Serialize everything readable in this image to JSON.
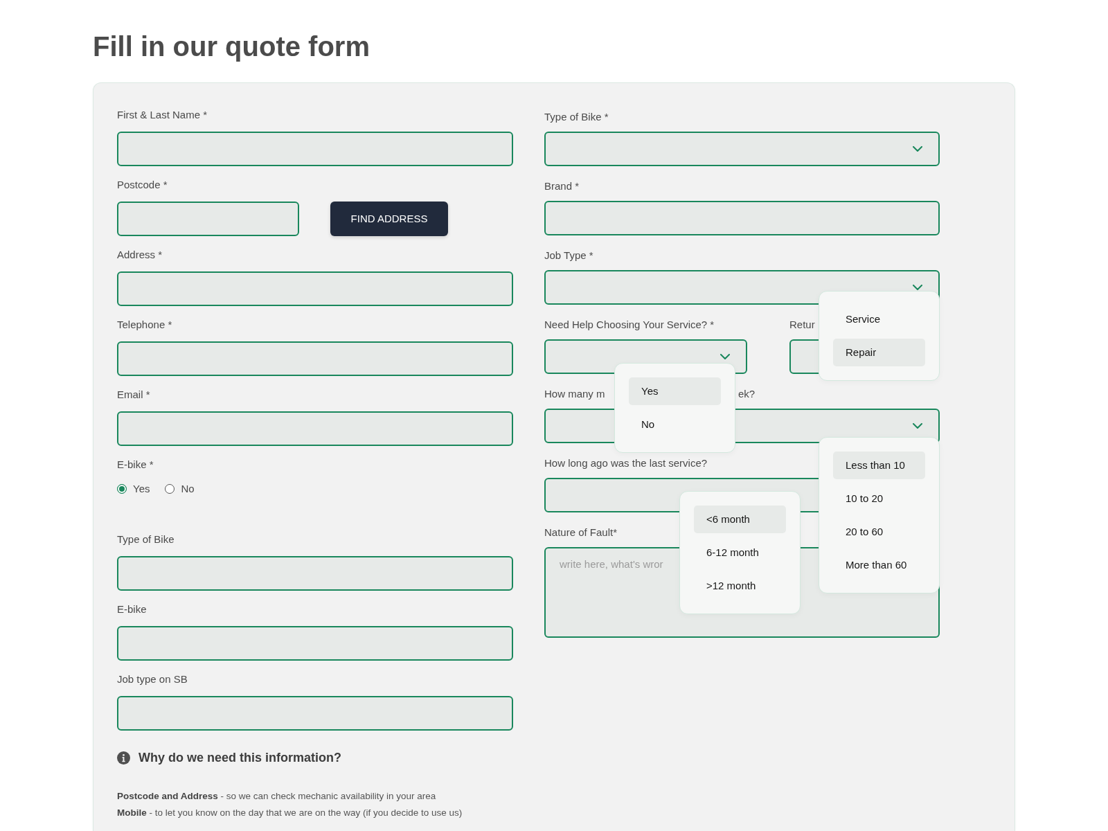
{
  "title": "Fill in our quote form",
  "left_fields": [
    {
      "kind": "input",
      "label": "First & Last Name *"
    },
    {
      "kind": "postcode",
      "label": "Postcode *",
      "button": "FIND ADDRESS"
    },
    {
      "kind": "input",
      "label": "Address *"
    },
    {
      "kind": "input",
      "label": "Telephone *"
    },
    {
      "kind": "input",
      "label": "Email *"
    },
    {
      "kind": "radio",
      "label": "E-bike *",
      "options": [
        {
          "label": "Yes",
          "selected": true
        },
        {
          "label": "No",
          "selected": false
        }
      ]
    },
    {
      "kind": "input",
      "label": "Type of Bike"
    },
    {
      "kind": "input",
      "label": "E-bike"
    },
    {
      "kind": "input",
      "label": "Job type on SB"
    }
  ],
  "right_fields": [
    {
      "kind": "select",
      "label": "Type of Bike *"
    },
    {
      "kind": "input",
      "label": "Brand *"
    },
    {
      "kind": "select",
      "label": "Job Type *",
      "menu": [
        {
          "label": "Service",
          "selected": false
        },
        {
          "label": "Repair",
          "selected": true
        }
      ]
    },
    {
      "kind": "pair",
      "fields": [
        {
          "kind": "select",
          "label": "Need Help Choosing Your Service? *",
          "menu": [
            {
              "label": "Yes",
              "selected": true
            },
            {
              "label": "No",
              "selected": false
            }
          ]
        },
        {
          "kind": "input",
          "label": "Retur"
        }
      ]
    },
    {
      "kind": "select",
      "label": "How many m",
      "label_end": "ek?",
      "menu": [
        {
          "label": "Less than 10",
          "selected": true
        },
        {
          "label": "10 to 20",
          "selected": false
        },
        {
          "label": "20 to 60",
          "selected": false
        },
        {
          "label": "More than 60",
          "selected": false
        }
      ]
    },
    {
      "kind": "input",
      "label": "How long ago was the last service?",
      "menu": [
        {
          "label": "<6 month",
          "selected": true
        },
        {
          "label": "6-12 month",
          "selected": false
        },
        {
          "label": ">12 month",
          "selected": false
        }
      ]
    },
    {
      "kind": "textarea",
      "label": "Nature of Fault*",
      "placeholder": "write here, what's wror"
    }
  ],
  "info": {
    "heading": "Why do we need this information?",
    "lines": [
      "**Postcode and Address** - so we can check mechanic availability in your area",
      "**Mobile** - to let you know on the day that we are on the way (if you decide to use us)"
    ]
  }
}
